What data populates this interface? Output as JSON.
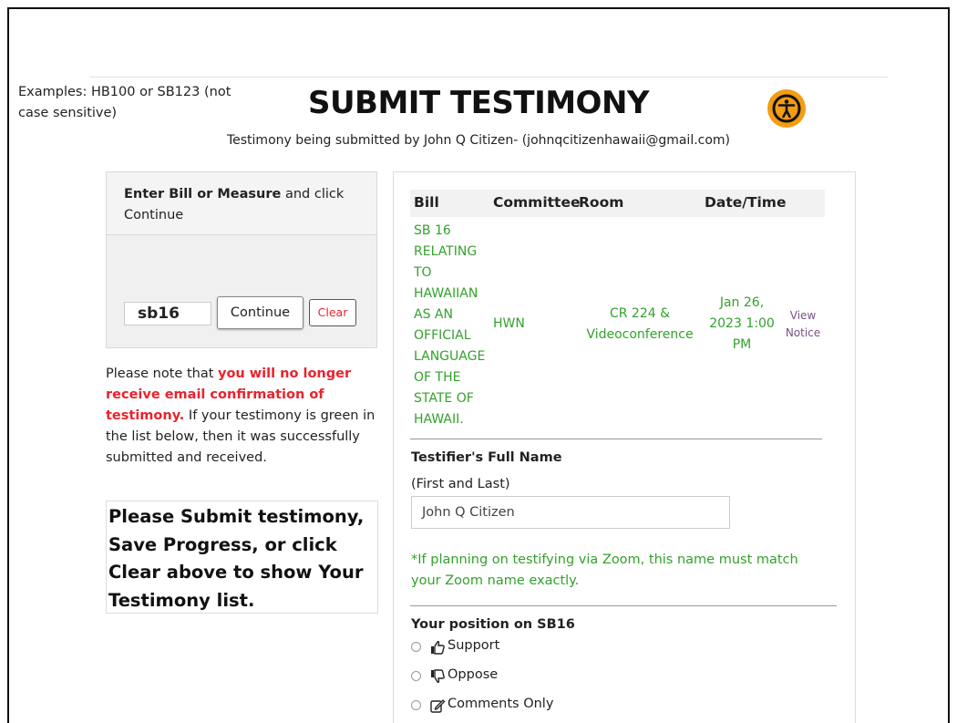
{
  "page": {
    "title": "SUBMIT TESTIMONY",
    "subtitle": "Testimony being submitted by John Q Citizen- (johnqcitizenhawaii@gmail.com)"
  },
  "bill_entry": {
    "heading_bold": "Enter Bill or Measure",
    "heading_rest": " and click Continue",
    "examples": "Examples: HB100 or SB123 (not case sensitive)",
    "input_value": "sb16",
    "continue_label": "Continue",
    "clear_label": "Clear"
  },
  "notice": {
    "prefix": "Please note that ",
    "highlight": "you will no longer receive email confirmation of testimony.",
    "suffix": " If your testimony is green in the list below, then it was successfully submitted and received."
  },
  "submit_prompt": "Please Submit testimony, Save Progress, or click Clear above to show Your Testimony list.",
  "hearing_table": {
    "headers": {
      "bill": "Bill",
      "committee": "Committee",
      "room": "Room",
      "datetime": "Date/Time"
    },
    "row": {
      "bill_lines": [
        "SB 16",
        "RELATING",
        "TO",
        "HAWAIIAN",
        "AS AN",
        "OFFICIAL",
        "LANGUAGE",
        "OF THE",
        "STATE OF",
        "HAWAII."
      ],
      "committee": "HWN",
      "room_lines": [
        "CR 224 &",
        "Videoconference"
      ],
      "datetime_lines": [
        "Jan 26,",
        "2023 1:00",
        "PM"
      ],
      "notice_link_lines": [
        "View",
        "Notice"
      ]
    }
  },
  "testifier": {
    "label": "Testifier's Full Name",
    "sublabel": "(First and Last)",
    "value": "John Q Citizen",
    "zoom_note": "*If planning on testifying via Zoom, this name must match your Zoom name exactly."
  },
  "position": {
    "label": "Your position on SB16",
    "options": [
      {
        "label": "Support",
        "icon": "thumbs-up-icon"
      },
      {
        "label": "Oppose",
        "icon": "thumbs-down-icon"
      },
      {
        "label": "Comments Only",
        "icon": "edit-icon"
      }
    ]
  },
  "colors": {
    "accent_green": "#33a12c",
    "alert_red": "#e8232d",
    "a11y_orange": "#f39c12",
    "link_purple": "#7b4f8a"
  }
}
